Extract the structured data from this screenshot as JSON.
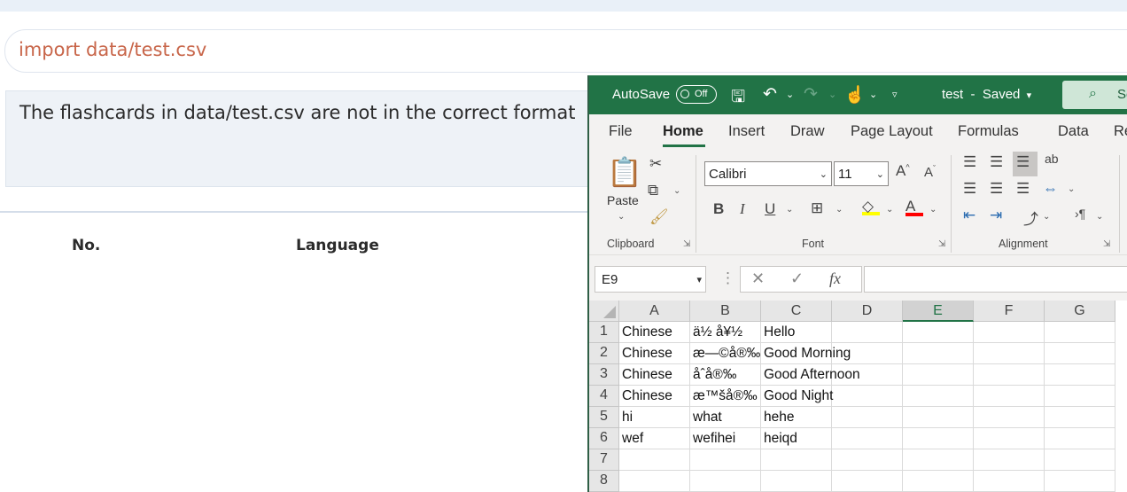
{
  "webapp": {
    "command_text": "import data/test.csv",
    "message": "The flashcards in data/test.csv are not in the correct format",
    "columns": [
      "No.",
      "Language"
    ]
  },
  "excel": {
    "autosave_label": "AutoSave",
    "autosave_state": "Off",
    "file_title": "test",
    "save_status": "Saved",
    "search_label": "Se",
    "tabs": [
      "File",
      "Home",
      "Insert",
      "Draw",
      "Page Layout",
      "Formulas",
      "Data",
      "Revi"
    ],
    "active_tab": "Home",
    "clipboard": {
      "paste_label": "Paste",
      "group_label": "Clipboard"
    },
    "font": {
      "name": "Calibri",
      "size": "11",
      "group_label": "Font"
    },
    "alignment": {
      "group_label": "Alignment"
    },
    "name_box": "E9",
    "column_headers": [
      "A",
      "B",
      "C",
      "D",
      "E",
      "F",
      "G"
    ],
    "selected_column": "E",
    "row_headers": [
      "1",
      "2",
      "3",
      "4",
      "5",
      "6",
      "7",
      "8"
    ],
    "rows": [
      [
        "Chinese",
        "ä½ å¥½",
        "Hello"
      ],
      [
        "Chinese",
        "æ—©å®‰",
        "Good Morning"
      ],
      [
        "Chinese",
        "åˆå®‰",
        "Good Afternoon"
      ],
      [
        "Chinese",
        "æ™šå®‰",
        "Good Night"
      ],
      [
        "hi",
        "what",
        "hehe"
      ],
      [
        "wef",
        "wefihei",
        "heiqd"
      ]
    ],
    "colors": {
      "brand": "#217346",
      "font_highlight": "#ffff00",
      "font_color": "#ff0000"
    }
  }
}
